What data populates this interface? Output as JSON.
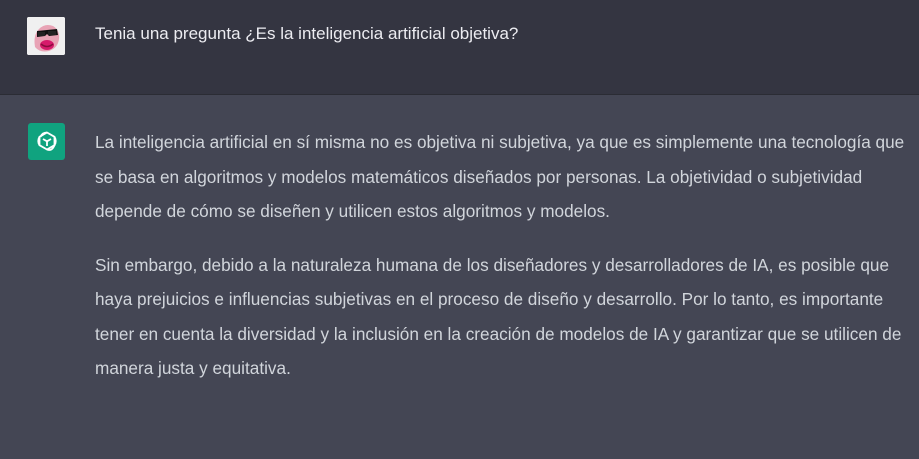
{
  "user_message": {
    "text": "Tenia una pregunta ¿Es la inteligencia artificial objetiva?",
    "avatar_icon": "user-avatar-pink-sunglasses-icon"
  },
  "assistant_message": {
    "avatar_icon": "openai-logo-icon",
    "paragraphs": [
      "La inteligencia artificial en sí misma no es objetiva ni subjetiva, ya que es simplemente una tecnología que se basa en algoritmos y modelos matemáticos diseñados por personas. La objetividad o subjetividad depende de cómo se diseñen y utilicen estos algoritmos y modelos.",
      "Sin embargo, debido a la naturaleza humana de los diseñadores y desarrolladores de IA, es posible que haya prejuicios e influencias subjetivas en el proceso de diseño y desarrollo. Por lo tanto, es importante tener en cuenta la diversidad y la inclusión en la creación de modelos de IA y garantizar que se utilicen de manera justa y equitativa."
    ]
  },
  "colors": {
    "user_row_bg": "#343541",
    "assistant_row_bg": "#444654",
    "assistant_avatar_bg": "#10a37f",
    "text": "#d1d5db"
  }
}
